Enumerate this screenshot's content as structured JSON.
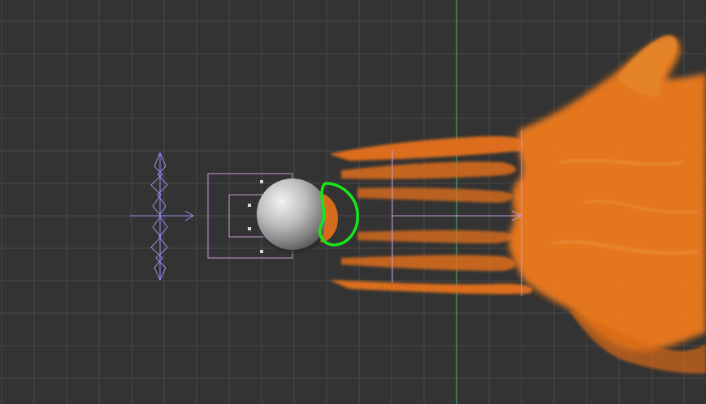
{
  "viewport": {
    "view": "orthographic-top",
    "background_color": "#333333",
    "grid_color": "#484848",
    "axis_color": "#3fbf6a"
  },
  "scene": {
    "objects": [
      {
        "name": "wind-force-field",
        "type": "force-field",
        "icon": "wind-icon",
        "color": "#8f8ff0"
      },
      {
        "name": "emitter-box",
        "type": "bounding-box",
        "color": "#c79ad6"
      },
      {
        "name": "collision-sphere",
        "type": "sphere",
        "color": "#d9d9d9",
        "selected": false
      },
      {
        "name": "particle-cloud",
        "type": "particle-system",
        "color": "#f07a1e"
      },
      {
        "name": "domain-bounds",
        "type": "bounding-box",
        "color": "#c79ad6"
      }
    ],
    "highlight": {
      "name": "selection-highlight",
      "color": "#19e619",
      "target": "particles-behind-sphere"
    }
  }
}
